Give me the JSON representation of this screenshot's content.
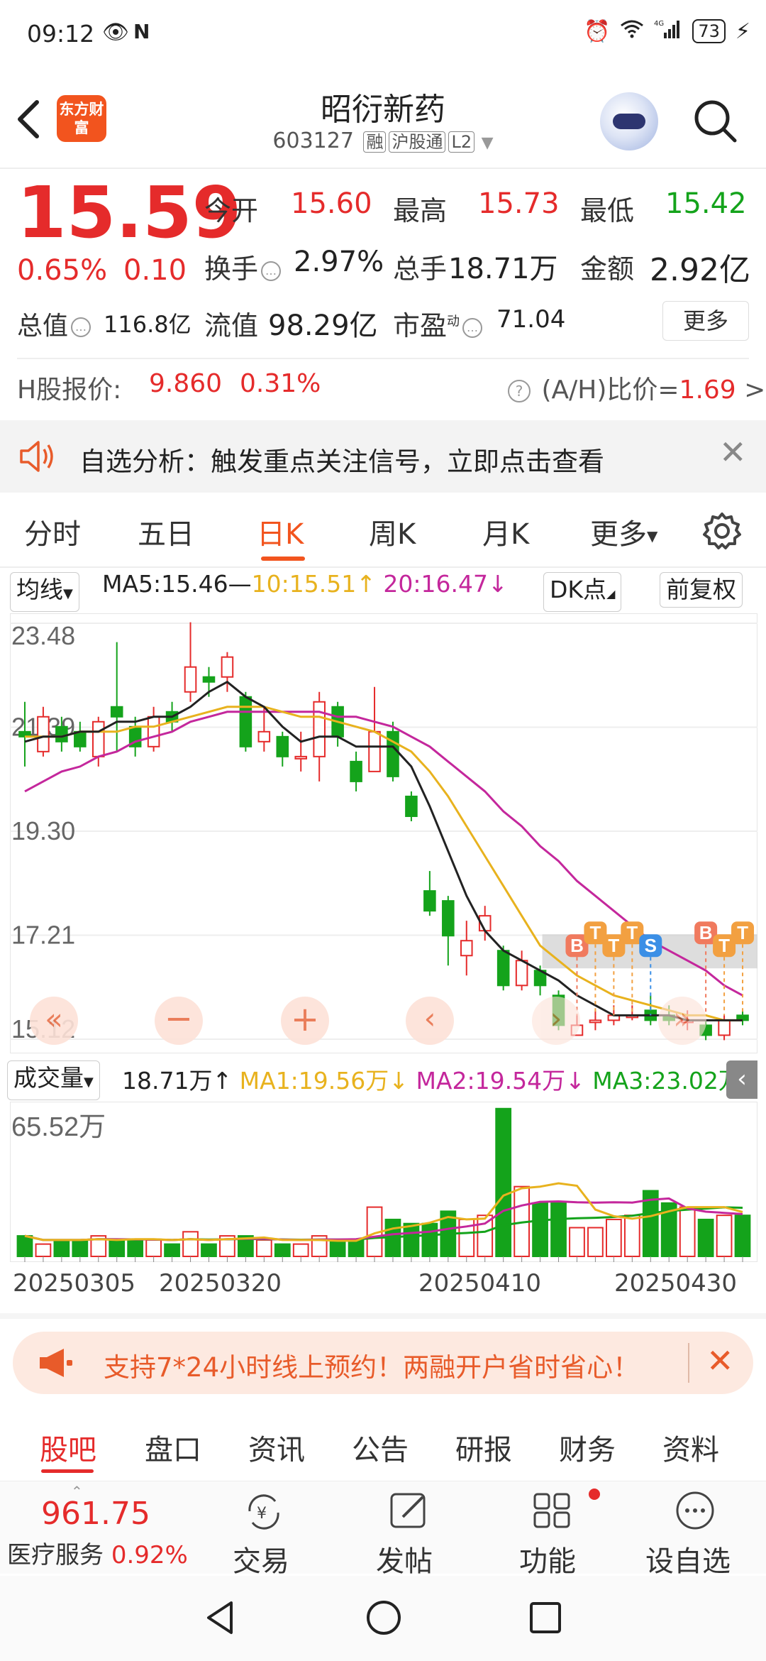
{
  "status_bar": {
    "time": "09:12",
    "battery": "73"
  },
  "header": {
    "logo_text": "东方财富",
    "stock_name": "昭衍新药",
    "stock_code": "603127",
    "tags": [
      "融",
      "沪股通",
      "L2"
    ]
  },
  "quote": {
    "price": "15.59",
    "change_pct": "0.65%",
    "change_abs": "0.10",
    "open_label": "今开",
    "open": "15.60",
    "high_label": "最高",
    "high": "15.73",
    "low_label": "最低",
    "low": "15.42",
    "turnover_label": "换手",
    "turnover": "2.97%",
    "volume_label": "总手",
    "volume": "18.71万",
    "amount_label": "金额",
    "amount": "2.92亿",
    "mktcap_label": "总值",
    "mktcap": "116.8亿",
    "float_label": "流值",
    "float": "98.29亿",
    "pe_label": "市盈",
    "pe_sup": "动",
    "pe": "71.04",
    "more_label": "更多"
  },
  "hk": {
    "label": "H股报价:",
    "price": "9.860",
    "pct": "0.31%",
    "ratio_label": "(A/H)比价=",
    "ratio": "1.69",
    "arrow": ">"
  },
  "notice": {
    "text": "自选分析：触发重点关注信号，立即点击查看"
  },
  "tabs": [
    {
      "label": "分时"
    },
    {
      "label": "五日"
    },
    {
      "label": "日K"
    },
    {
      "label": "周K"
    },
    {
      "label": "月K"
    },
    {
      "label": "更多"
    }
  ],
  "toolbar": {
    "indicator": "均线",
    "ma5": "MA5:15.46",
    "ma10": "10:15.51",
    "ma20": "20:16.47",
    "dk": "DK点",
    "adjust": "前复权"
  },
  "volume_bar": {
    "indicator": "成交量",
    "vol": "18.71万",
    "ma1": "MA1:19.56万",
    "ma2": "MA2:19.54万",
    "ma3": "MA3:23.02万"
  },
  "chart_data": {
    "type": "candlestick",
    "y_ticks": [
      "23.48",
      "21.39",
      "19.30",
      "17.21",
      "15.12"
    ],
    "ylim": [
      15.12,
      23.48
    ],
    "vol_max_label": "65.52万",
    "x_ticks": [
      "20250305",
      "20250320",
      "20250410",
      "20250430"
    ],
    "candles": [
      {
        "o": 21.2,
        "c": 21.3,
        "h": 21.9,
        "l": 20.6,
        "up": false
      },
      {
        "o": 20.9,
        "c": 21.6,
        "h": 21.8,
        "l": 20.8,
        "up": true
      },
      {
        "o": 21.4,
        "c": 21.1,
        "h": 21.6,
        "l": 20.9,
        "up": false
      },
      {
        "o": 21.0,
        "c": 21.3,
        "h": 21.5,
        "l": 20.9,
        "up": false
      },
      {
        "o": 20.8,
        "c": 21.5,
        "h": 21.6,
        "l": 20.6,
        "up": true
      },
      {
        "o": 21.8,
        "c": 21.6,
        "h": 23.1,
        "l": 20.9,
        "up": false
      },
      {
        "o": 21.4,
        "c": 21.0,
        "h": 21.6,
        "l": 20.8,
        "up": false
      },
      {
        "o": 21.0,
        "c": 21.6,
        "h": 21.8,
        "l": 20.9,
        "up": true
      },
      {
        "o": 21.7,
        "c": 21.5,
        "h": 21.9,
        "l": 21.3,
        "up": false
      },
      {
        "o": 22.1,
        "c": 22.6,
        "h": 23.5,
        "l": 21.9,
        "up": true
      },
      {
        "o": 22.4,
        "c": 22.3,
        "h": 22.6,
        "l": 22.0,
        "up": false
      },
      {
        "o": 22.4,
        "c": 22.8,
        "h": 22.9,
        "l": 22.1,
        "up": true
      },
      {
        "o": 22.0,
        "c": 21.0,
        "h": 22.1,
        "l": 20.9,
        "up": false
      },
      {
        "o": 21.1,
        "c": 21.3,
        "h": 21.8,
        "l": 20.9,
        "up": true
      },
      {
        "o": 21.2,
        "c": 20.8,
        "h": 21.3,
        "l": 20.6,
        "up": false
      },
      {
        "o": 20.8,
        "c": 20.8,
        "h": 21.3,
        "l": 20.5,
        "up": true
      },
      {
        "o": 20.8,
        "c": 21.9,
        "h": 22.1,
        "l": 20.3,
        "up": true
      },
      {
        "o": 21.8,
        "c": 21.2,
        "h": 21.9,
        "l": 21.0,
        "up": false
      },
      {
        "o": 20.7,
        "c": 20.3,
        "h": 20.9,
        "l": 20.1,
        "up": false
      },
      {
        "o": 20.5,
        "c": 21.3,
        "h": 22.2,
        "l": 20.5,
        "up": true
      },
      {
        "o": 21.3,
        "c": 20.4,
        "h": 21.5,
        "l": 20.3,
        "up": false
      },
      {
        "o": 20.0,
        "c": 19.6,
        "h": 20.1,
        "l": 19.5,
        "up": false
      },
      {
        "o": 18.1,
        "c": 17.7,
        "h": 18.5,
        "l": 17.6,
        "up": false
      },
      {
        "o": 17.9,
        "c": 17.2,
        "h": 18.0,
        "l": 16.6,
        "up": false
      },
      {
        "o": 16.8,
        "c": 17.1,
        "h": 17.5,
        "l": 16.4,
        "up": true
      },
      {
        "o": 17.3,
        "c": 17.6,
        "h": 17.8,
        "l": 17.1,
        "up": true
      },
      {
        "o": 16.9,
        "c": 16.2,
        "h": 17.0,
        "l": 16.1,
        "up": false
      },
      {
        "o": 16.2,
        "c": 16.7,
        "h": 16.9,
        "l": 16.1,
        "up": true
      },
      {
        "o": 16.5,
        "c": 16.2,
        "h": 16.6,
        "l": 16.0,
        "up": false
      },
      {
        "o": 16.0,
        "c": 15.4,
        "h": 16.1,
        "l": 15.3,
        "up": false
      },
      {
        "o": 15.2,
        "c": 15.4,
        "h": 15.6,
        "l": 15.2,
        "up": true
      },
      {
        "o": 15.5,
        "c": 15.5,
        "h": 15.7,
        "l": 15.3,
        "up": true
      },
      {
        "o": 15.5,
        "c": 15.6,
        "h": 15.8,
        "l": 15.4,
        "up": true
      },
      {
        "o": 15.6,
        "c": 15.6,
        "h": 15.8,
        "l": 15.5,
        "up": true
      },
      {
        "o": 15.7,
        "c": 15.5,
        "h": 16.0,
        "l": 15.4,
        "up": false
      },
      {
        "o": 15.6,
        "c": 15.5,
        "h": 15.8,
        "l": 15.4,
        "up": false
      },
      {
        "o": 15.5,
        "c": 15.5,
        "h": 15.7,
        "l": 15.3,
        "up": true
      },
      {
        "o": 15.4,
        "c": 15.2,
        "h": 15.5,
        "l": 15.1,
        "up": false
      },
      {
        "o": 15.2,
        "c": 15.5,
        "h": 15.6,
        "l": 15.1,
        "up": true
      },
      {
        "o": 15.5,
        "c": 15.6,
        "h": 15.7,
        "l": 15.4,
        "up": false
      }
    ],
    "ma5": [
      21.1,
      21.2,
      21.2,
      21.3,
      21.3,
      21.5,
      21.5,
      21.6,
      21.6,
      21.8,
      22.1,
      22.3,
      22.0,
      21.8,
      21.4,
      21.1,
      21.2,
      21.2,
      21.0,
      21.0,
      21.0,
      20.6,
      19.8,
      18.9,
      18.0,
      17.3,
      16.9,
      16.7,
      16.5,
      16.3,
      16.0,
      15.8,
      15.6,
      15.6,
      15.6,
      15.6,
      15.5,
      15.5,
      15.5,
      15.5
    ],
    "ma10": [
      21.2,
      21.2,
      21.2,
      21.3,
      21.3,
      21.3,
      21.4,
      21.4,
      21.5,
      21.6,
      21.7,
      21.8,
      21.8,
      21.8,
      21.7,
      21.6,
      21.6,
      21.5,
      21.4,
      21.3,
      21.1,
      20.9,
      20.5,
      20.0,
      19.4,
      18.8,
      18.2,
      17.6,
      17.0,
      16.7,
      16.4,
      16.2,
      16.0,
      15.9,
      15.8,
      15.7,
      15.6,
      15.6,
      15.5,
      15.5
    ],
    "ma20": [
      20.1,
      20.3,
      20.5,
      20.6,
      20.8,
      20.9,
      21.1,
      21.2,
      21.3,
      21.5,
      21.6,
      21.7,
      21.7,
      21.7,
      21.7,
      21.7,
      21.7,
      21.6,
      21.6,
      21.5,
      21.4,
      21.2,
      21.0,
      20.7,
      20.4,
      20.1,
      19.7,
      19.4,
      19.0,
      18.7,
      18.3,
      18.0,
      17.7,
      17.4,
      17.1,
      16.9,
      16.7,
      16.5,
      16.2,
      16.0
    ],
    "volumes": [
      0.5,
      0.3,
      0.4,
      0.4,
      0.5,
      0.4,
      0.4,
      0.4,
      0.3,
      0.6,
      0.3,
      0.5,
      0.5,
      0.4,
      0.3,
      0.3,
      0.5,
      0.4,
      0.4,
      1.2,
      0.9,
      0.8,
      0.8,
      1.1,
      0.9,
      1.0,
      3.6,
      1.7,
      1.3,
      1.3,
      0.7,
      0.7,
      0.9,
      1.0,
      1.6,
      1.3,
      1.2,
      0.9,
      1.0,
      1.0
    ],
    "signals": [
      {
        "label": "B",
        "idx": 30
      },
      {
        "label": "T",
        "idx": 31
      },
      {
        "label": "T",
        "idx": 32
      },
      {
        "label": "T",
        "idx": 33
      },
      {
        "label": "S",
        "idx": 34
      },
      {
        "label": "B",
        "idx": 37
      },
      {
        "label": "T",
        "idx": 38
      },
      {
        "label": "T",
        "idx": 39
      }
    ]
  },
  "banner": {
    "text": "支持7*24小时线上预约！两融开户省时省心！"
  },
  "bottom_tabs": [
    {
      "label": "股吧"
    },
    {
      "label": "盘口"
    },
    {
      "label": "资讯"
    },
    {
      "label": "公告"
    },
    {
      "label": "研报"
    },
    {
      "label": "财务"
    },
    {
      "label": "资料"
    }
  ],
  "bottom_bar": {
    "index_value": "961.75",
    "index_name": "医疗服务",
    "index_pct": "0.92%",
    "trade": "交易",
    "post": "发帖",
    "function": "功能",
    "watchlist": "设自选"
  }
}
